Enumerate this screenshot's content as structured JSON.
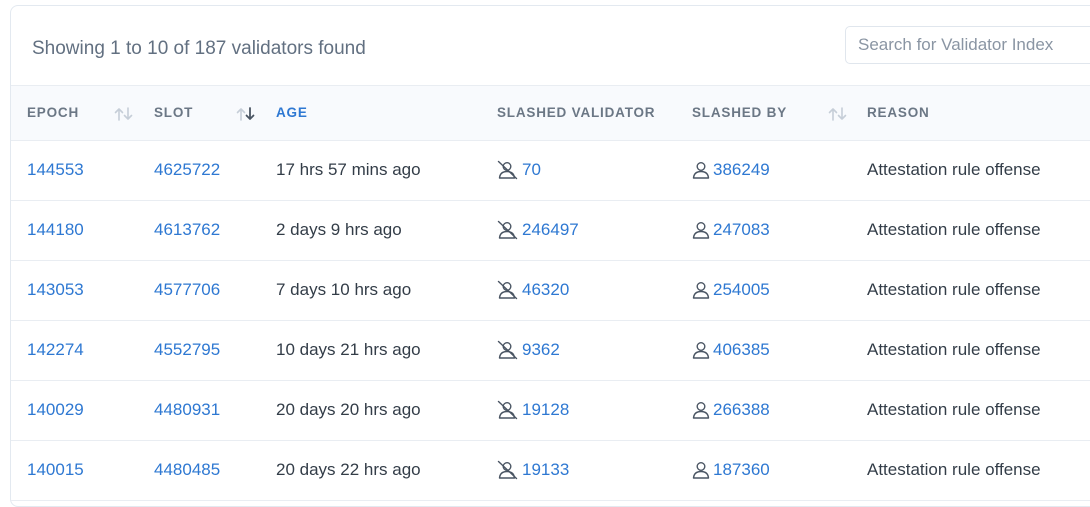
{
  "summary": "Showing 1 to 10 of 187 validators found",
  "search": {
    "placeholder": "Search for Validator Index"
  },
  "columns": {
    "epoch": "EPOCH",
    "slot": "SLOT",
    "age": "AGE",
    "slashed_validator": "SLASHED VALIDATOR",
    "slashed_by": "SLASHED BY",
    "reason": "REASON"
  },
  "sort": {
    "epoch": "unsorted",
    "slot": "descending",
    "slashed_by": "unsorted"
  },
  "icons": {
    "slashed_validator": "user-slash-icon",
    "slashed_by": "user-icon",
    "sort": "sort-arrows-icon"
  },
  "colors": {
    "link": "#2e78d2",
    "text": "#333d48",
    "header_text": "#6b7785",
    "sort_icon": "#c6ced8"
  },
  "rows": [
    {
      "epoch": "144553",
      "slot": "4625722",
      "age": "17 hrs 57 mins ago",
      "slashed_validator": "70",
      "slashed_by": "386249",
      "reason": "Attestation rule offense"
    },
    {
      "epoch": "144180",
      "slot": "4613762",
      "age": "2 days 9 hrs ago",
      "slashed_validator": "246497",
      "slashed_by": "247083",
      "reason": "Attestation rule offense"
    },
    {
      "epoch": "143053",
      "slot": "4577706",
      "age": "7 days 10 hrs ago",
      "slashed_validator": "46320",
      "slashed_by": "254005",
      "reason": "Attestation rule offense"
    },
    {
      "epoch": "142274",
      "slot": "4552795",
      "age": "10 days 21 hrs ago",
      "slashed_validator": "9362",
      "slashed_by": "406385",
      "reason": "Attestation rule offense"
    },
    {
      "epoch": "140029",
      "slot": "4480931",
      "age": "20 days 20 hrs ago",
      "slashed_validator": "19128",
      "slashed_by": "266388",
      "reason": "Attestation rule offense"
    },
    {
      "epoch": "140015",
      "slot": "4480485",
      "age": "20 days 22 hrs ago",
      "slashed_validator": "19133",
      "slashed_by": "187360",
      "reason": "Attestation rule offense"
    }
  ]
}
